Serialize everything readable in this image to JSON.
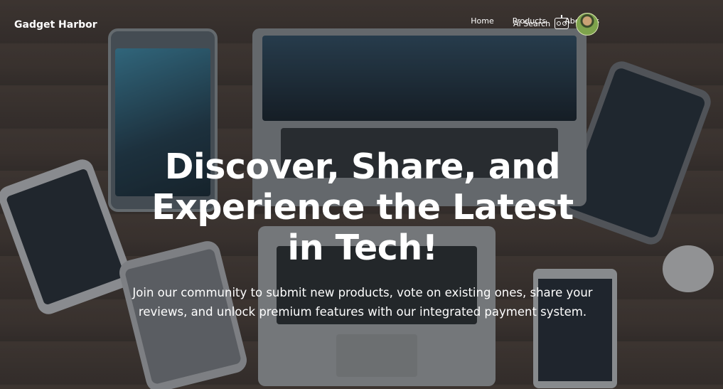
{
  "brand": "Gadget Harbor",
  "nav": {
    "home": "Home",
    "products": "Products",
    "about": "About us",
    "ai_search": "AI Search",
    "ai_icon": "robot-icon"
  },
  "hero": {
    "headline": "Discover, Share, and Experience the Latest in Tech!",
    "subtext": "Join our community to submit new products, vote on existing ones, share your reviews, and unlock premium features with our integrated payment system."
  },
  "colors": {
    "text": "#ffffff",
    "overlay": "#232224"
  }
}
